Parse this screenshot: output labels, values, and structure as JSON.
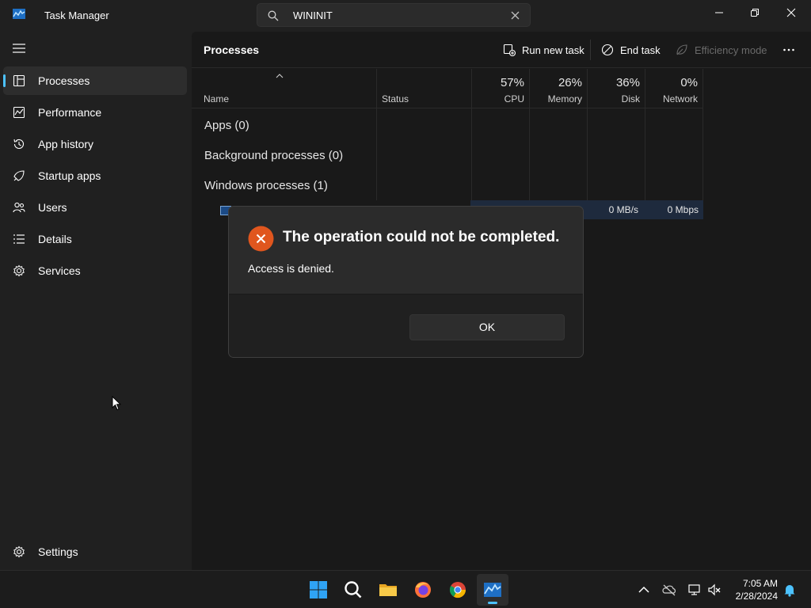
{
  "window": {
    "title": "Task Manager",
    "search_value": "WININIT"
  },
  "sidebar": {
    "items": [
      {
        "label": "Processes",
        "icon": "processes-icon",
        "active": true
      },
      {
        "label": "Performance",
        "icon": "performance-icon"
      },
      {
        "label": "App history",
        "icon": "app-history-icon"
      },
      {
        "label": "Startup apps",
        "icon": "startup-apps-icon"
      },
      {
        "label": "Users",
        "icon": "users-icon"
      },
      {
        "label": "Details",
        "icon": "details-icon"
      },
      {
        "label": "Services",
        "icon": "services-icon"
      }
    ],
    "settings_label": "Settings"
  },
  "toolbar": {
    "title": "Processes",
    "run_new_task": "Run new task",
    "end_task": "End task",
    "efficiency_mode": "Efficiency mode"
  },
  "columns": {
    "name": "Name",
    "status": "Status",
    "cpu": {
      "pct": "57%",
      "label": "CPU"
    },
    "memory": {
      "pct": "26%",
      "label": "Memory"
    },
    "disk": {
      "pct": "36%",
      "label": "Disk"
    },
    "network": {
      "pct": "0%",
      "label": "Network"
    }
  },
  "groups": [
    {
      "label": "Apps (0)"
    },
    {
      "label": "Background processes (0)"
    },
    {
      "label": "Windows processes (1)"
    }
  ],
  "process_row": {
    "disk": "0 MB/s",
    "network": "0 Mbps"
  },
  "dialog": {
    "title": "The operation could not be completed.",
    "message": "Access is denied.",
    "ok_label": "OK"
  },
  "taskbar": {
    "time": "7:05 AM",
    "date": "2/28/2024"
  },
  "colors": {
    "accent": "#4cc2ff",
    "error": "#e0561e"
  }
}
